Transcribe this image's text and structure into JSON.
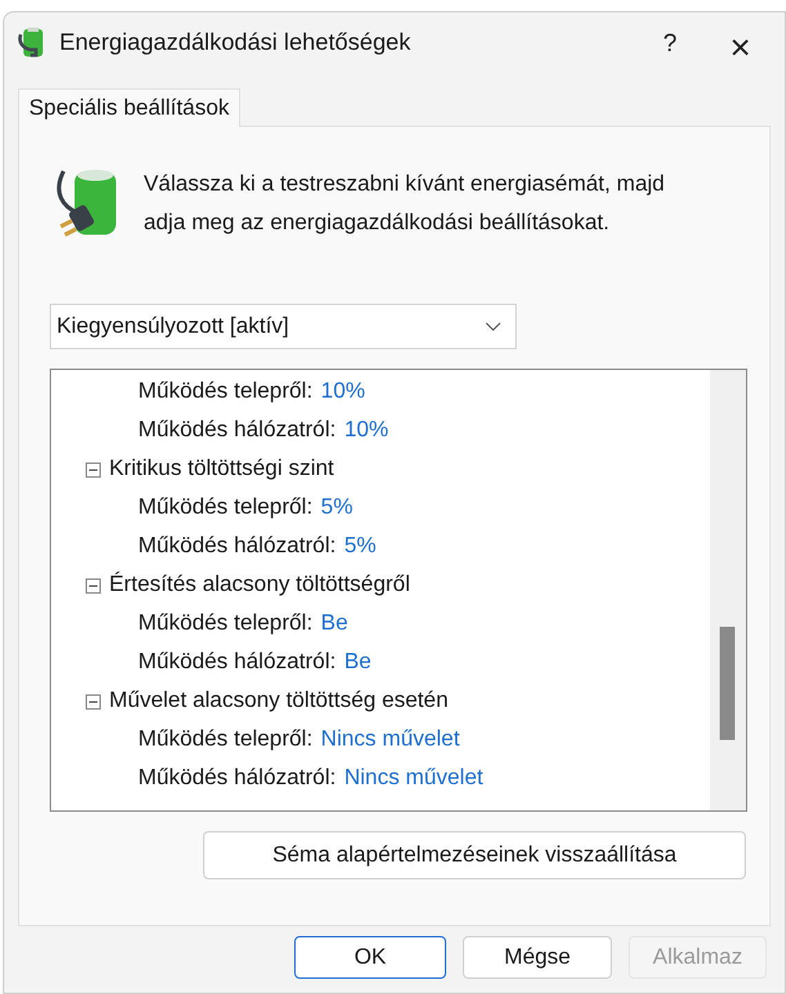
{
  "window": {
    "title": "Energiagazdálkodási lehetőségek",
    "help": "?",
    "close": "×"
  },
  "tabs": [
    {
      "label": "Speciális beállítások",
      "selected": true
    }
  ],
  "intro": "Válassza ki a testreszabni kívánt energiasémát, majd adja meg az energiagazdálkodási beállításokat.",
  "scheme_dropdown": {
    "value": "Kiegyensúlyozott [aktív]"
  },
  "tree": [
    {
      "children": [
        {
          "label": "Működés telepről:",
          "value": "10%"
        },
        {
          "label": "Működés hálózatról:",
          "value": "10%"
        }
      ]
    },
    {
      "label": "Kritikus töltöttségi szint",
      "expanded": true,
      "children": [
        {
          "label": "Működés telepről:",
          "value": "5%"
        },
        {
          "label": "Működés hálózatról:",
          "value": "5%"
        }
      ]
    },
    {
      "label": "Értesítés alacsony töltöttségről",
      "expanded": true,
      "children": [
        {
          "label": "Működés telepről:",
          "value": "Be"
        },
        {
          "label": "Működés hálózatról:",
          "value": "Be"
        }
      ]
    },
    {
      "label": "Művelet alacsony töltöttség esetén",
      "expanded": true,
      "children": [
        {
          "label": "Működés telepről:",
          "value": "Nincs művelet"
        },
        {
          "label": "Működés hálózatról:",
          "value": "Nincs művelet"
        }
      ]
    }
  ],
  "restore_button": "Séma alapértelmezéseinek visszaállítása",
  "buttons": [
    {
      "label": "OK",
      "default": true,
      "disabled": false
    },
    {
      "label": "Mégse",
      "default": false,
      "disabled": false
    },
    {
      "label": "Alkalmaz",
      "default": false,
      "disabled": true
    }
  ]
}
